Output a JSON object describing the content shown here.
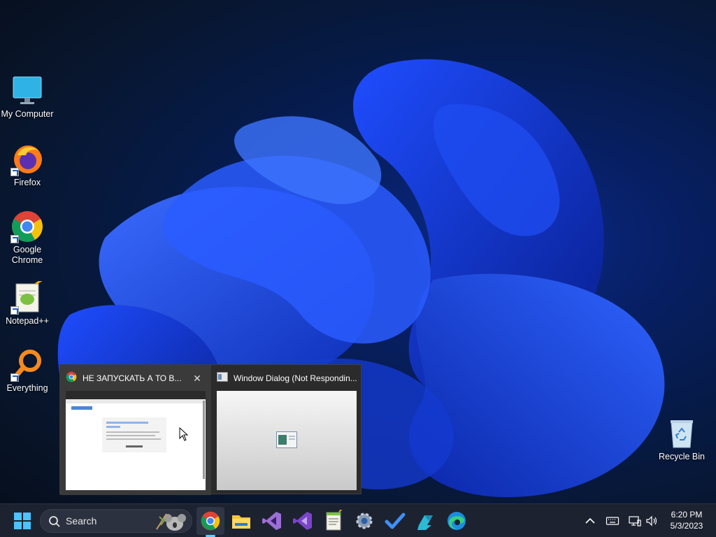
{
  "desktop": {
    "icons": [
      {
        "label": "My Computer",
        "icon": "monitor-icon"
      },
      {
        "label": "Firefox",
        "icon": "firefox-icon"
      },
      {
        "label": "Google Chrome",
        "icon": "chrome-icon"
      },
      {
        "label": "Notepad++",
        "icon": "notepad-plus-plus-icon"
      },
      {
        "label": "Everything",
        "icon": "everything-search-icon"
      },
      {
        "label": "Recycle Bin",
        "icon": "recycle-bin-icon"
      }
    ]
  },
  "thumbnails": [
    {
      "title": "НЕ ЗАПУСКАТЬ А ТО В...",
      "icon": "chrome-icon",
      "close": "✕",
      "preview": "browser page preview"
    },
    {
      "title": "Window Dialog (Not Respondin...",
      "icon": "window-icon",
      "preview": "blank dialog preview"
    }
  ],
  "taskbar": {
    "search_placeholder": "Search",
    "apps": [
      "chrome-icon",
      "file-explorer-icon",
      "visual-studio-code-purple-icon",
      "visual-studio-icon",
      "notepad-icon",
      "settings-gear-icon",
      "todo-check-icon",
      "azure-devops-icon",
      "edge-icon"
    ],
    "tray": [
      "chevron-up-icon",
      "keyboard-icon",
      "network-icon",
      "volume-icon"
    ],
    "time": "6:20 PM",
    "date": "5/3/2023"
  },
  "colors": {
    "accent": "#60cdff",
    "taskbar": "#1c2230"
  }
}
